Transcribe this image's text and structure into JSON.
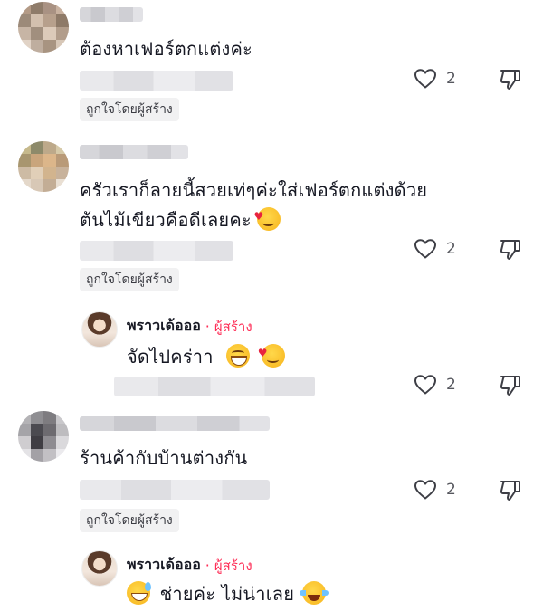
{
  "comments": [
    {
      "text_lines": [
        "ต้องหาเฟอร์ตกแต่งค่ะ"
      ],
      "like_count": "2",
      "liked_badge": "ถูกใจโดยผู้สร้าง"
    },
    {
      "text_lines": [
        "ครัวเราก็ลายนี้สวยเท่ๆค่ะใส่เฟอร์ตกแต่งด้วย",
        "ต้นไม้เขียวคือดีเลยคะ"
      ],
      "like_count": "2",
      "liked_badge": "ถูกใจโดยผู้สร้าง"
    },
    {
      "text_lines": [
        "ร้านค้ากับบ้านต่างกัน"
      ],
      "like_count": "2",
      "liked_badge": "ถูกใจโดยผู้สร้าง"
    }
  ],
  "replies": [
    {
      "author": "พราวเด้อออ",
      "dot": "·",
      "creator_label": "ผู้สร้าง",
      "text": "จัดไปคร่าา",
      "like_count": "2"
    },
    {
      "author": "พราวเด้อออ",
      "dot": "·",
      "creator_label": "ผู้สร้าง",
      "text_a": "ช่ายค่ะ ไม่น่าเลย"
    }
  ],
  "icons": {
    "like": "heart-outline-icon",
    "dislike": "thumbs-down-icon",
    "accent": "#fe2c55",
    "text_color": "#161823",
    "muted_color": "#57585f"
  }
}
